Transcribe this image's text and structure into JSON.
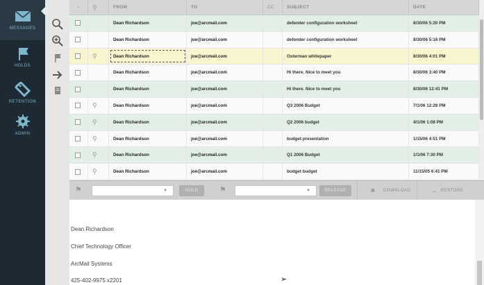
{
  "nav": {
    "items": [
      {
        "label": "MESSAGES",
        "icon": "envelope-icon"
      },
      {
        "label": "HOLDS",
        "icon": "flag-icon"
      },
      {
        "label": "RETENTION",
        "icon": "tag-icon"
      },
      {
        "label": "ADMIN",
        "icon": "gear-icon"
      }
    ]
  },
  "grid": {
    "columns": [
      "",
      "",
      "FROM",
      "TO",
      "CC",
      "SUBJECT",
      "DATE"
    ],
    "rows": [
      {
        "from": "Dean Richardson",
        "to": "joe@arcmail.com",
        "subject": "defender configuration worksheet",
        "date": "8/30/06 5:20 PM",
        "att": false
      },
      {
        "from": "Dean Richardson",
        "to": "joe@arcmail.com",
        "subject": "defender configuration worksheet",
        "date": "8/30/06 5:16 PM",
        "att": false
      },
      {
        "from": "Dean Richardson",
        "to": "joe@arcmail.com",
        "subject": "Osterman whitepaper",
        "date": "8/30/06 4:01 PM",
        "att": true
      },
      {
        "from": "Dean Richardson",
        "to": "joe@arcmail.com",
        "subject": "Hi there. Nice to meet you",
        "date": "8/30/06 3:40 PM",
        "att": false
      },
      {
        "from": "Dean Richardson",
        "to": "joe@arcmail.com",
        "subject": "Hi there. Nice to meet you",
        "date": "8/30/06 12:41 PM",
        "att": false
      },
      {
        "from": "Dean Richardson",
        "to": "joe@arcmail.com",
        "subject": "Q3 2006 Budget",
        "date": "7/1/06 12:28 PM",
        "att": true
      },
      {
        "from": "Dean Richardson",
        "to": "joe@arcmail.com",
        "subject": "Q2 2006 budget",
        "date": "4/1/06 1:08 PM",
        "att": true
      },
      {
        "from": "Dean Richardson",
        "to": "joe@arcmail.com",
        "subject": "budget presentation",
        "date": "1/15/06 4:51 PM",
        "att": true
      },
      {
        "from": "Dean Richardson",
        "to": "joe@arcmail.com",
        "subject": "Q1 2006 Budget",
        "date": "1/1/06 7:30 PM",
        "att": true
      },
      {
        "from": "Dean Richardson",
        "to": "joe@arcmail.com",
        "subject": "budget budget",
        "date": "11/15/05 6:41 PM",
        "att": true
      }
    ]
  },
  "toolbar": {
    "hold_label": "HOLD",
    "release_label": "RELEASE",
    "download_label": "DOWNLOAD",
    "restore_label": "RESTORE"
  },
  "preview": {
    "lines": [
      "Dean Richardson",
      "Chief Technology Officer",
      "ArcMail Systems",
      "425-402-9975 x2201"
    ]
  }
}
